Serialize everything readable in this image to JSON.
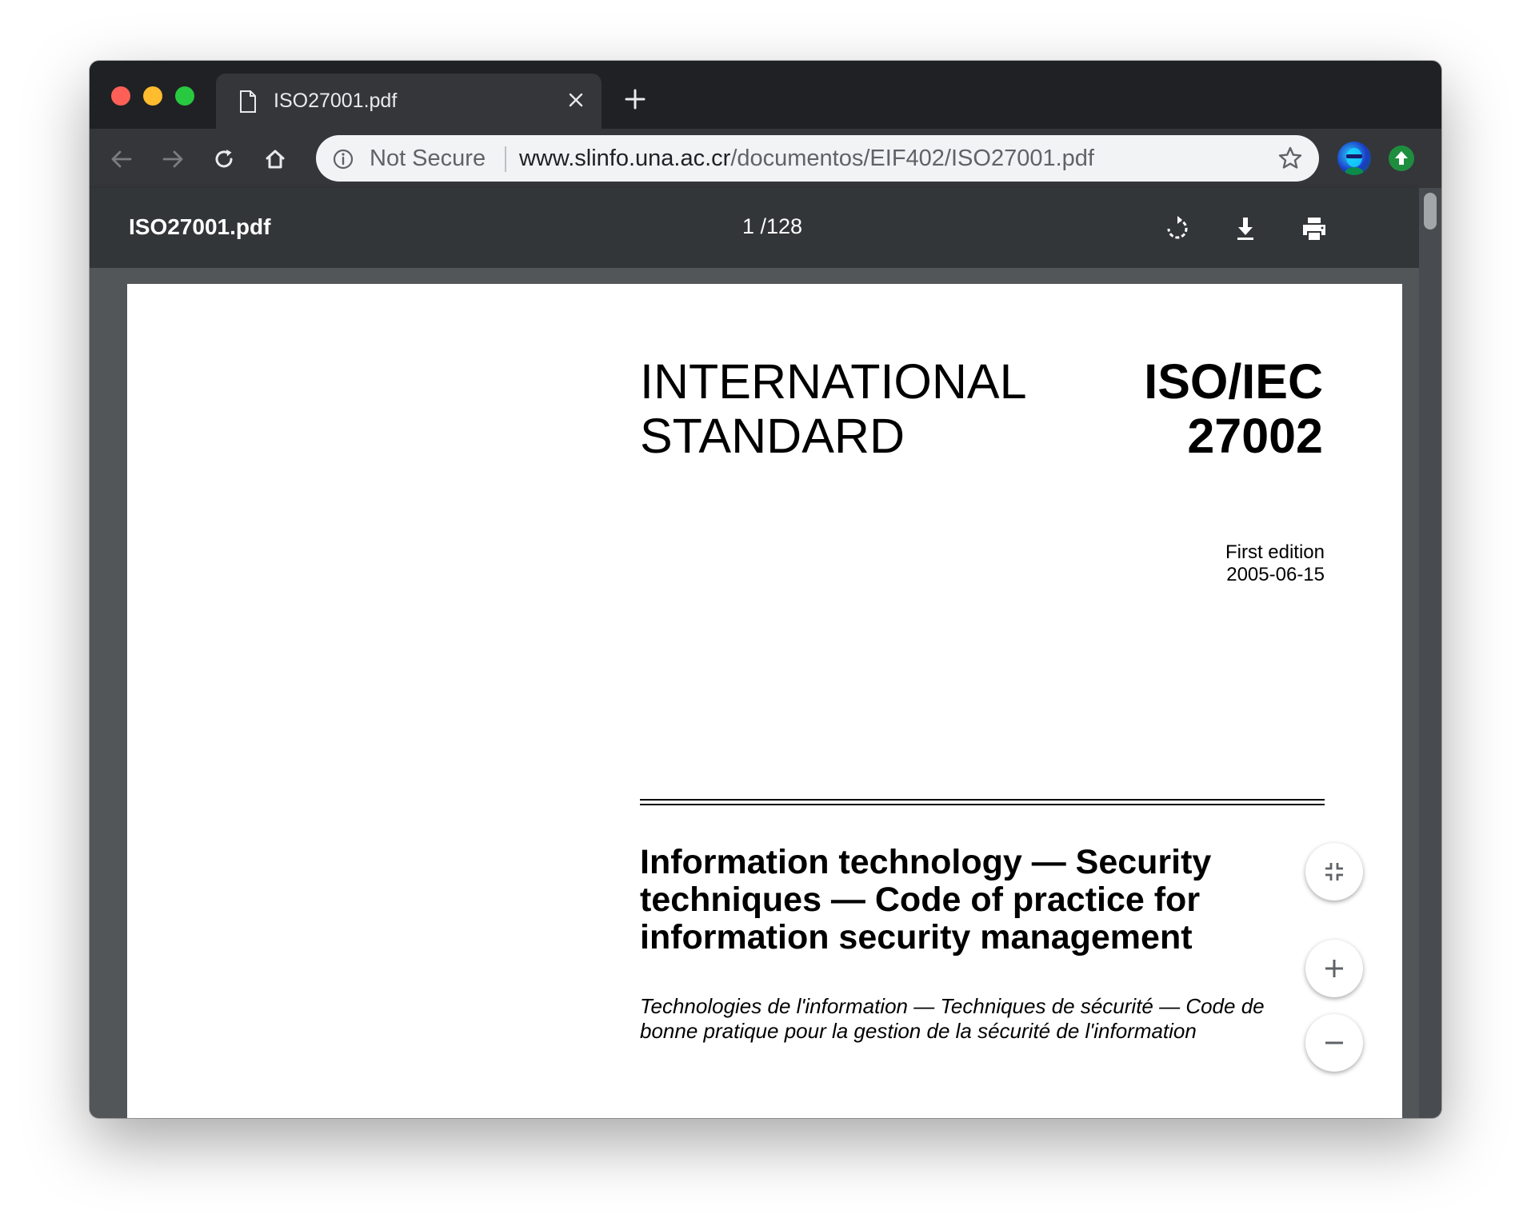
{
  "tab": {
    "title": "ISO27001.pdf"
  },
  "omnibox": {
    "security_label": "Not Secure",
    "url_host": "www.slinfo.una.ac.cr",
    "url_path": "/documentos/EIF402/ISO27001.pdf"
  },
  "pdf_toolbar": {
    "filename": "ISO27001.pdf",
    "page_indicator": "1 /128"
  },
  "document": {
    "heading_left_line1": "INTERNATIONAL",
    "heading_left_line2": "STANDARD",
    "heading_right_line1": "ISO/IEC",
    "heading_right_line2": "27002",
    "edition": "First edition",
    "date": "2005-06-15",
    "title": "Information technology — Security techniques — Code of practice for information security management",
    "subtitle": "Technologies de l'information — Techniques de sécurité — Code de bonne pratique pour la gestion de la sécurité de l'information"
  },
  "colors": {
    "window_dark": "#202124",
    "toolbar": "#35363a",
    "pdf_toolbar": "#323639",
    "viewer_bg": "#525659",
    "traffic_red": "#fe5f57",
    "traffic_yellow": "#febc2e",
    "traffic_green": "#28c840",
    "extension_green": "#1e8e3e"
  },
  "icons": {
    "tab": [
      "file-icon",
      "close-icon",
      "plus-icon"
    ],
    "navigation": [
      "back-arrow-icon",
      "forward-arrow-icon",
      "reload-icon",
      "home-icon"
    ],
    "omnibox": [
      "info-icon",
      "star-icon"
    ],
    "pdf_toolbar": [
      "rotate-icon",
      "download-icon",
      "print-icon"
    ],
    "zoom": [
      "fit-page-icon",
      "zoom-in-icon",
      "zoom-out-icon"
    ]
  }
}
